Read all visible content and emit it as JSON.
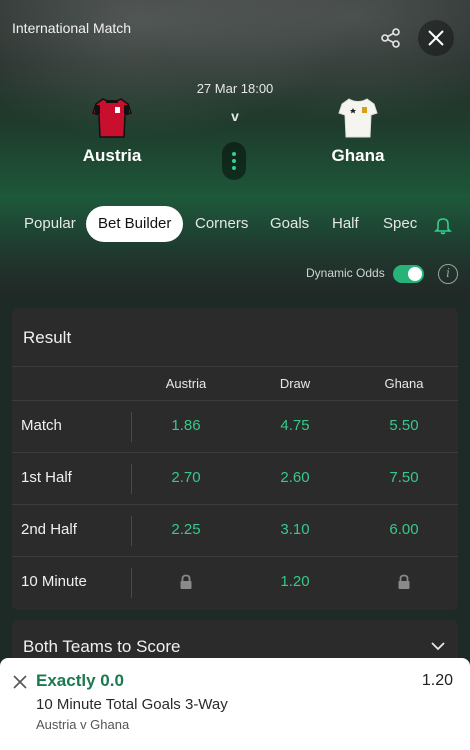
{
  "header": {
    "title": "International Match",
    "date": "27 Mar 18:00",
    "vs": "v",
    "home_team": "Austria",
    "away_team": "Ghana"
  },
  "tabs": [
    {
      "label": "Popular",
      "active": false
    },
    {
      "label": "Bet Builder",
      "active": true
    },
    {
      "label": "Corners",
      "active": false
    },
    {
      "label": "Goals",
      "active": false
    },
    {
      "label": "Half",
      "active": false
    },
    {
      "label": "Spec",
      "active": false
    }
  ],
  "dynamic_odds": {
    "label": "Dynamic Odds",
    "enabled": true
  },
  "result_market": {
    "title": "Result",
    "columns": [
      "Austria",
      "Draw",
      "Ghana"
    ],
    "rows": [
      {
        "label": "Match",
        "odds": [
          "1.86",
          "4.75",
          "5.50"
        ]
      },
      {
        "label": "1st Half",
        "odds": [
          "2.70",
          "2.60",
          "7.50"
        ]
      },
      {
        "label": "2nd Half",
        "odds": [
          "2.25",
          "3.10",
          "6.00"
        ]
      },
      {
        "label": "10 Minute",
        "odds": [
          "",
          "1.20",
          ""
        ],
        "locked": [
          true,
          false,
          true
        ]
      }
    ]
  },
  "btts_market": {
    "title": "Both Teams to Score"
  },
  "bet_slip": {
    "selection": "Exactly 0.0",
    "odds": "1.20",
    "market": "10 Minute Total Goals 3-Way",
    "event": "Austria v Ghana"
  },
  "colors": {
    "accent": "#35c98a",
    "selection": "#1a7a4f",
    "toggle": "#27b277"
  }
}
